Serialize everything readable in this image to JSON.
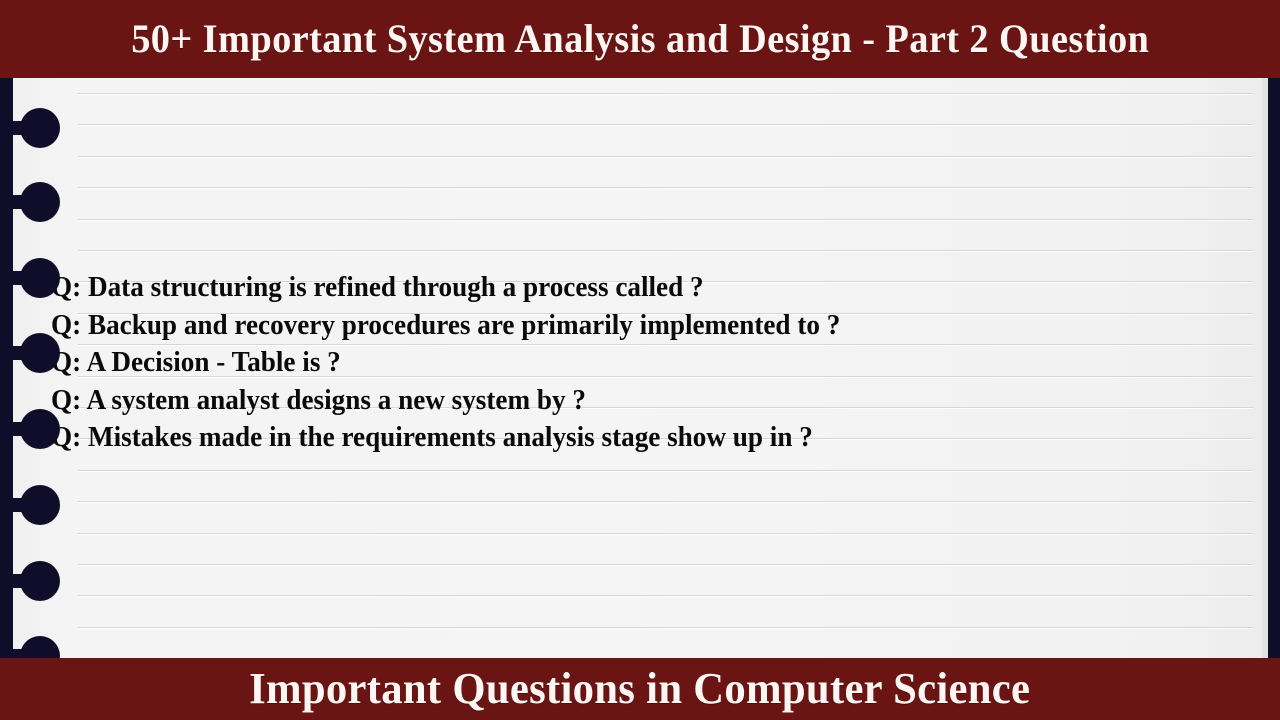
{
  "header": {
    "title": "50+ Important System Analysis and Design - Part 2 Question",
    "background_color": "#6b1414",
    "text_color": "#fdf6f2"
  },
  "footer": {
    "title": "Important Questions in Computer Science",
    "background_color": "#6b1414",
    "text_color": "#fdf6f2"
  },
  "notepad": {
    "paper_color": "#f3f3f3",
    "rule_color": "#d6d6d6",
    "spiral_color": "#100d2a",
    "ruled_line_count": 18,
    "spiral_ring_count": 7
  },
  "questions": [
    {
      "text": "Q: Data structuring is refined through a process called ?"
    },
    {
      "text": "Q: Backup and recovery procedures are primarily implemented to ?"
    },
    {
      "text": "Q: A Decision - Table is ?"
    },
    {
      "text": "Q: A system analyst designs a new system by ?"
    },
    {
      "text": "Q: Mistakes made in the requirements analysis stage show up in ?"
    }
  ]
}
